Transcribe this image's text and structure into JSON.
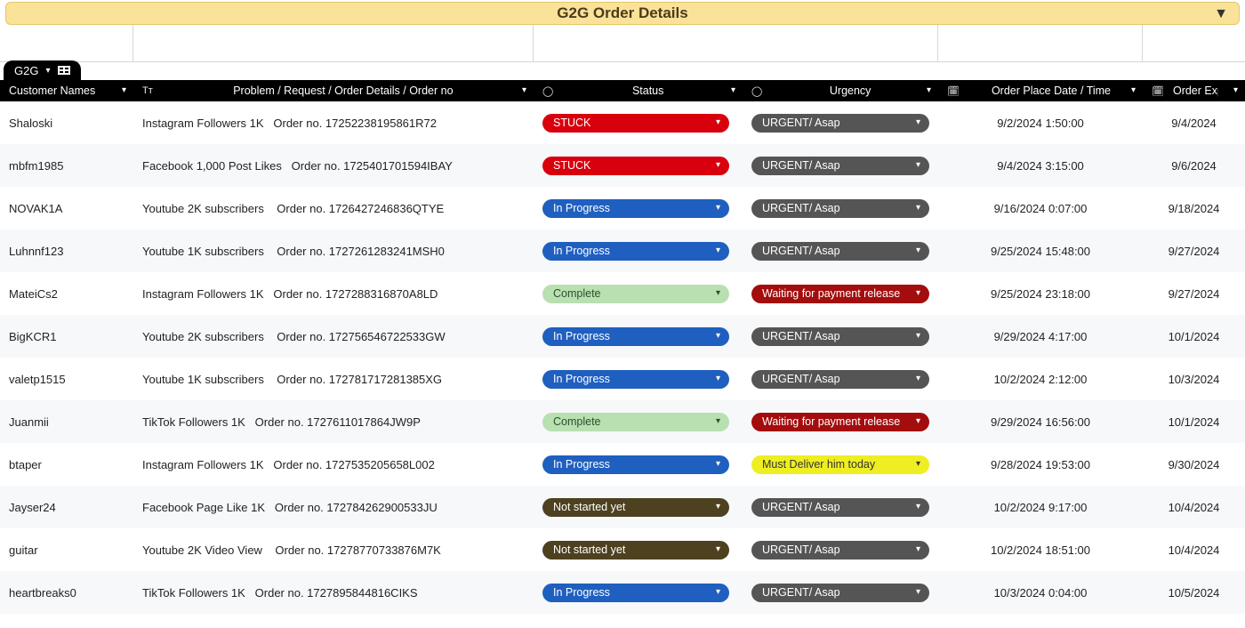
{
  "title": "G2G Order Details",
  "tab": {
    "label": "G2G"
  },
  "columns": {
    "customer": "Customer Names",
    "details": "Problem / Request / Order Details / Order no",
    "status": "Status",
    "urgency": "Urgency",
    "date": "Order Place Date / Time",
    "expire": "Order Expire"
  },
  "rows": [
    {
      "name": "Shaloski",
      "details": "Instagram Followers 1K   Order no. 17252238195861R72",
      "status": {
        "text": "STUCK",
        "cls": "pill-red"
      },
      "urgency": {
        "text": "URGENT/ Asap",
        "cls": "pill-gray"
      },
      "date": "9/2/2024 1:50:00",
      "expire": "9/4/2024"
    },
    {
      "name": "mbfm1985",
      "details": "Facebook 1,000 Post Likes   Order no. 1725401701594IBAY",
      "status": {
        "text": "STUCK",
        "cls": "pill-red"
      },
      "urgency": {
        "text": "URGENT/ Asap",
        "cls": "pill-gray"
      },
      "date": "9/4/2024 3:15:00",
      "expire": "9/6/2024"
    },
    {
      "name": "NOVAK1A",
      "details": "Youtube 2K subscribers    Order no. 1726427246836QTYE",
      "status": {
        "text": "In Progress",
        "cls": "pill-blue"
      },
      "urgency": {
        "text": "URGENT/ Asap",
        "cls": "pill-gray"
      },
      "date": "9/16/2024 0:07:00",
      "expire": "9/18/2024"
    },
    {
      "name": "Luhnnf123",
      "details": "Youtube 1K subscribers    Order no. 1727261283241MSH0",
      "status": {
        "text": "In Progress",
        "cls": "pill-blue"
      },
      "urgency": {
        "text": "URGENT/ Asap",
        "cls": "pill-gray"
      },
      "date": "9/25/2024 15:48:00",
      "expire": "9/27/2024"
    },
    {
      "name": "MateiCs2",
      "details": "Instagram Followers 1K   Order no. 1727288316870A8LD",
      "status": {
        "text": "Complete",
        "cls": "pill-green"
      },
      "urgency": {
        "text": "Waiting for payment release",
        "cls": "pill-darkred"
      },
      "date": "9/25/2024 23:18:00",
      "expire": "9/27/2024"
    },
    {
      "name": "BigKCR1",
      "details": "Youtube 2K subscribers    Order no. 172756546722533GW",
      "status": {
        "text": "In Progress",
        "cls": "pill-blue"
      },
      "urgency": {
        "text": "URGENT/ Asap",
        "cls": "pill-gray"
      },
      "date": "9/29/2024 4:17:00",
      "expire": "10/1/2024"
    },
    {
      "name": "valetp1515",
      "details": "Youtube 1K subscribers    Order no. 172781717281385XG",
      "status": {
        "text": "In Progress",
        "cls": "pill-blue"
      },
      "urgency": {
        "text": "URGENT/ Asap",
        "cls": "pill-gray"
      },
      "date": "10/2/2024 2:12:00",
      "expire": "10/3/2024"
    },
    {
      "name": "Juanmii",
      "details": "TikTok Followers 1K   Order no. 1727611017864JW9P",
      "status": {
        "text": "Complete",
        "cls": "pill-green"
      },
      "urgency": {
        "text": "Waiting for payment release",
        "cls": "pill-darkred"
      },
      "date": "9/29/2024 16:56:00",
      "expire": "10/1/2024"
    },
    {
      "name": "btaper",
      "details": "Instagram Followers 1K   Order no. 1727535205658L002",
      "status": {
        "text": "In Progress",
        "cls": "pill-blue"
      },
      "urgency": {
        "text": "Must Deliver him today",
        "cls": "pill-yellow"
      },
      "date": "9/28/2024 19:53:00",
      "expire": "9/30/2024"
    },
    {
      "name": "Jayser24",
      "details": "Facebook Page Like 1K   Order no. 172784262900533JU",
      "status": {
        "text": "Not started yet",
        "cls": "pill-olive"
      },
      "urgency": {
        "text": "URGENT/ Asap",
        "cls": "pill-gray"
      },
      "date": "10/2/2024 9:17:00",
      "expire": "10/4/2024"
    },
    {
      "name": "guitar",
      "details": "Youtube 2K Video View    Order no. 17278770733876M7K",
      "status": {
        "text": "Not started yet",
        "cls": "pill-olive"
      },
      "urgency": {
        "text": "URGENT/ Asap",
        "cls": "pill-gray"
      },
      "date": "10/2/2024 18:51:00",
      "expire": "10/4/2024"
    },
    {
      "name": "heartbreaks0",
      "details": "TikTok Followers 1K   Order no. 1727895844816CIKS",
      "status": {
        "text": "In Progress",
        "cls": "pill-blue"
      },
      "urgency": {
        "text": "URGENT/ Asap",
        "cls": "pill-gray"
      },
      "date": "10/3/2024 0:04:00",
      "expire": "10/5/2024"
    }
  ]
}
